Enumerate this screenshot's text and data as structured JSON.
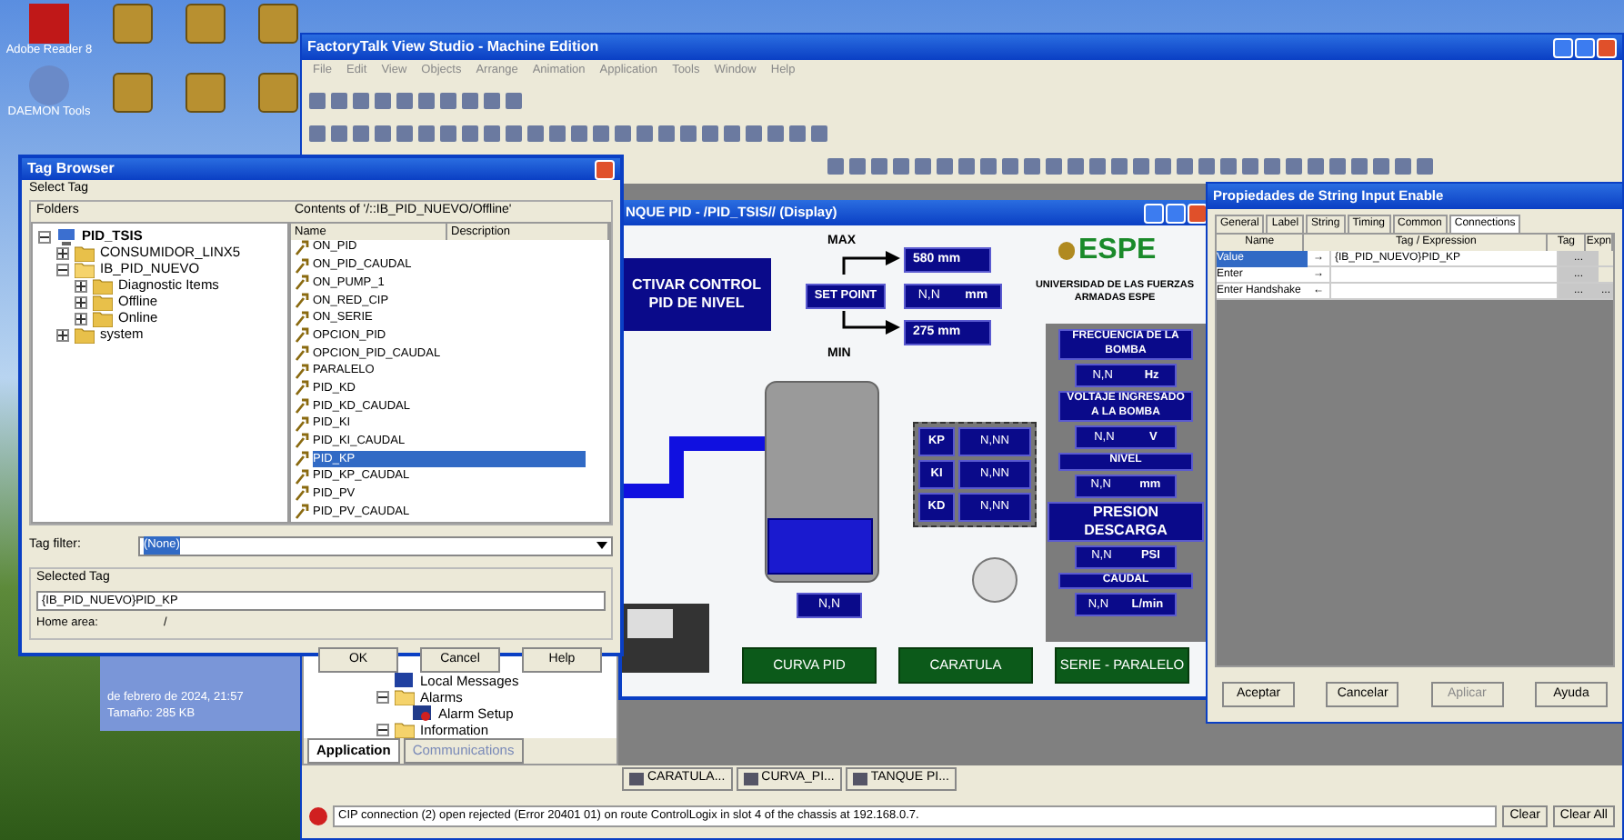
{
  "desktop": {
    "icons": [
      {
        "label": "Adobe Reader 8"
      },
      {
        "label": "DAEMON Tools"
      }
    ],
    "info_panel": {
      "lines": [
        "de febrero de 2024, 21:57",
        "Tamaño: 285 KB"
      ]
    }
  },
  "main_window": {
    "title": "FactoryTalk View Studio - Machine Edition",
    "menu": [
      "File",
      "Edit",
      "View",
      "Objects",
      "Arrange",
      "Animation",
      "Application",
      "Tools",
      "Window",
      "Help"
    ],
    "explorer": {
      "items": [
        {
          "label": "Local Messages",
          "kind": "messages"
        },
        {
          "label": "Alarms",
          "kind": "folder",
          "expanded": true,
          "children": [
            {
              "label": "Alarm Setup",
              "kind": "alarm"
            }
          ]
        },
        {
          "label": "Information",
          "kind": "folder",
          "expanded": true
        }
      ]
    },
    "explorer_tabs": [
      {
        "label": "Application",
        "selected": true
      },
      {
        "label": "Communications",
        "selected": false
      }
    ],
    "display_tabs": [
      {
        "label": "CARATULA..."
      },
      {
        "label": "CURVA_PI..."
      },
      {
        "label": "TANQUE PI..."
      }
    ],
    "diagnostics": {
      "message": "CIP connection (2) open rejected (Error 20401 01) on route ControlLogix in slot 4 of the chassis at 192.168.0.7.",
      "buttons": [
        "Clear",
        "Clear All"
      ]
    }
  },
  "display": {
    "title": "NQUE PID - /PID_TSIS// (Display)",
    "activate_button": "CTIVAR CONTROL PID DE NIVEL",
    "max_label": "MAX",
    "max_value": "580 mm",
    "setpoint_label": "SET POINT",
    "setpoint_value": "N,N",
    "setpoint_unit": "mm",
    "min_value": "275 mm",
    "min_label": "MIN",
    "logo": "ESPE",
    "university": "UNIVERSIDAD DE LAS FUERZAS ARMADAS ESPE",
    "tank": {
      "level": 0.3,
      "value": "N,N"
    },
    "gains": [
      {
        "label": "KP",
        "value": "N,NN"
      },
      {
        "label": "KI",
        "value": "N,NN"
      },
      {
        "label": "KD",
        "value": "N,NN"
      }
    ],
    "indicators": [
      {
        "title": "FRECUENCIA DE LA BOMBA",
        "value": "N,N",
        "unit": "Hz"
      },
      {
        "title": "VOLTAJE INGRESADO A LA BOMBA",
        "value": "N,N",
        "unit": "V"
      },
      {
        "title": "NIVEL",
        "value": "N,N",
        "unit": "mm"
      },
      {
        "title": "PRESION DESCARGA",
        "value": "N,N",
        "unit": "PSI"
      },
      {
        "title": "CAUDAL",
        "value": "N,N",
        "unit": "L/min"
      }
    ],
    "nav_buttons": [
      "CURVA PID",
      "CARATULA",
      "SERIE - PARALELO"
    ]
  },
  "properties": {
    "title": "Propiedades de String Input Enable",
    "tabs": [
      {
        "label": "General",
        "selected": false
      },
      {
        "label": "Label",
        "selected": false
      },
      {
        "label": "String",
        "selected": false
      },
      {
        "label": "Timing",
        "selected": false
      },
      {
        "label": "Common",
        "selected": false
      },
      {
        "label": "Connections",
        "selected": true
      }
    ],
    "columns": [
      "Name",
      "Tag / Expression",
      "Tag",
      "Expn"
    ],
    "rows": [
      {
        "name": "Value",
        "arrow": "→",
        "tag": "{IB_PID_NUEVO}PID_KP",
        "selected": true,
        "expr_button": false
      },
      {
        "name": "Enter",
        "arrow": "→",
        "tag": "",
        "selected": false,
        "expr_button": false
      },
      {
        "name": "Enter Handshake",
        "arrow": "←",
        "tag": "",
        "selected": false,
        "expr_button": true
      }
    ],
    "buttons": [
      {
        "label": "Aceptar",
        "disabled": false
      },
      {
        "label": "Cancelar",
        "disabled": false
      },
      {
        "label": "Aplicar",
        "disabled": true
      },
      {
        "label": "Ayuda",
        "disabled": false
      }
    ],
    "ellipsis": "..."
  },
  "tag_browser": {
    "title": "Tag Browser",
    "group": "Select Tag",
    "folders_label": "Folders",
    "folders": [
      {
        "label": "PID_TSIS",
        "kind": "project",
        "expanded": true,
        "children": [
          {
            "label": "CONSUMIDOR_LINX5",
            "kind": "folder",
            "expanded": false
          },
          {
            "label": "IB_PID_NUEVO",
            "kind": "folder",
            "expanded": true,
            "children": [
              {
                "label": "Diagnostic Items",
                "kind": "folder",
                "expanded": false
              },
              {
                "label": "Offline",
                "kind": "folder",
                "expanded": false
              },
              {
                "label": "Online",
                "kind": "folder",
                "expanded": false
              }
            ]
          },
          {
            "label": "system",
            "kind": "folder",
            "expanded": false
          }
        ]
      }
    ],
    "contents_label": "Contents of '/::IB_PID_NUEVO/Offline'",
    "columns": [
      "Name",
      "Description"
    ],
    "tags": [
      {
        "name": "ON_PID",
        "selected": false
      },
      {
        "name": "ON_PID_CAUDAL",
        "selected": false
      },
      {
        "name": "ON_PUMP_1",
        "selected": false
      },
      {
        "name": "ON_RED_CIP",
        "selected": false
      },
      {
        "name": "ON_SERIE",
        "selected": false
      },
      {
        "name": "OPCION_PID",
        "selected": false
      },
      {
        "name": "OPCION_PID_CAUDAL",
        "selected": false
      },
      {
        "name": "PARALELO",
        "selected": false
      },
      {
        "name": "PID_KD",
        "selected": false
      },
      {
        "name": "PID_KD_CAUDAL",
        "selected": false
      },
      {
        "name": "PID_KI",
        "selected": false
      },
      {
        "name": "PID_KI_CAUDAL",
        "selected": false
      },
      {
        "name": "PID_KP",
        "selected": true
      },
      {
        "name": "PID_KP_CAUDAL",
        "selected": false
      },
      {
        "name": "PID_PV",
        "selected": false
      },
      {
        "name": "PID_PV_CAUDAL",
        "selected": false
      }
    ],
    "filter_label": "Tag filter:",
    "filter_value": "(None)",
    "selected_group": "Selected Tag",
    "selected_value": "{IB_PID_NUEVO}PID_KP",
    "home_label": "Home area:",
    "home_value": "/",
    "buttons": [
      "OK",
      "Cancel",
      "Help"
    ]
  }
}
